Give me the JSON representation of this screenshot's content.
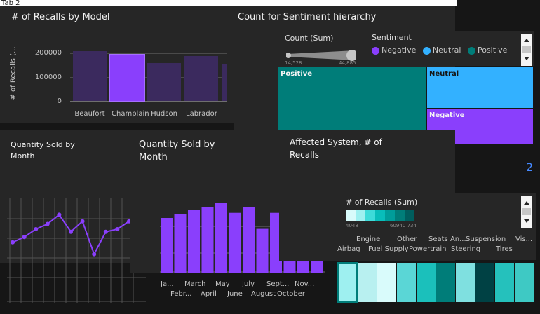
{
  "tab": {
    "label": "Tab 2"
  },
  "recalls_by_model": {
    "title": "# of Recalls by Model",
    "ylabel": "# of Recalls (...",
    "yticks": [
      "200000",
      "100000",
      "0"
    ]
  },
  "sentiment": {
    "title": "Count for Sentiment hierarchy",
    "count_label": "Count (Sum)",
    "count_min": "14,528",
    "count_max": "44,885",
    "legend_title": "Sentiment",
    "legend": [
      {
        "label": "Negative",
        "color": "#8a3ffc"
      },
      {
        "label": "Neutral",
        "color": "#33b1ff"
      },
      {
        "label": "Positive",
        "color": "#007d79"
      }
    ],
    "tiles": {
      "positive": "Positive",
      "neutral": "Neutral",
      "negative": "Negative"
    }
  },
  "qty_month_1": {
    "title_line1": "Quantity Sold by",
    "title_line2": "Month"
  },
  "qty_month_2": {
    "title_line1": "Quantity Sold by",
    "title_line2": "Month",
    "month_labels_top": [
      "Ja...",
      "March",
      "May",
      "July",
      "Sept...",
      "Nov..."
    ],
    "month_labels_bottom": [
      "Febr...",
      "April",
      "June",
      "August",
      "October"
    ]
  },
  "affected_system": {
    "title_line1": "Affected System, # of",
    "title_line2": "Recalls",
    "legend_title": "# of Recalls (Sum)",
    "legend_min": "4048",
    "legend_max": "60940 734",
    "cats_top": [
      "Engine",
      "Other",
      "Seats An...",
      "Suspension",
      "Vis..."
    ],
    "cats_bottom": [
      "Airbag",
      "Fuel Supply",
      "Powertrain",
      "Steering",
      "Tires"
    ]
  },
  "page_number": "2",
  "chart_data": [
    {
      "type": "bar",
      "title": "# of Recalls by Model",
      "ylabel": "# of Recalls (...",
      "categories": [
        "Beaufort",
        "Champlain",
        "Hudson",
        "Labrador"
      ],
      "values": [
        238000,
        217000,
        180000,
        212000
      ],
      "ylim": [
        0,
        240000
      ]
    },
    {
      "type": "line",
      "title": "Quantity Sold by Month",
      "values": [
        46,
        50,
        56,
        60,
        67,
        54,
        62,
        37,
        54,
        56,
        62
      ]
    },
    {
      "type": "bar",
      "title": "Quantity Sold by Month",
      "values": [
        75,
        80,
        86,
        90,
        96,
        82,
        90,
        60,
        82,
        50,
        52,
        56
      ]
    },
    {
      "type": "heatmap",
      "title": "Affected System, # of Recalls",
      "categories": [
        "Airbag",
        "Engine",
        "Fuel Supply",
        "Other",
        "Powertrain",
        "Seats An...",
        "Steering",
        "Suspension",
        "Tires",
        "Vis..."
      ],
      "colors": [
        "#9ef0f0",
        "#b8f0f0",
        "#d9fbfb",
        "#5ad6d6",
        "#1bc0bb",
        "#007d79",
        "#7fe0e0",
        "#004144",
        "#25c1bc",
        "#3ec9c4"
      ]
    }
  ]
}
